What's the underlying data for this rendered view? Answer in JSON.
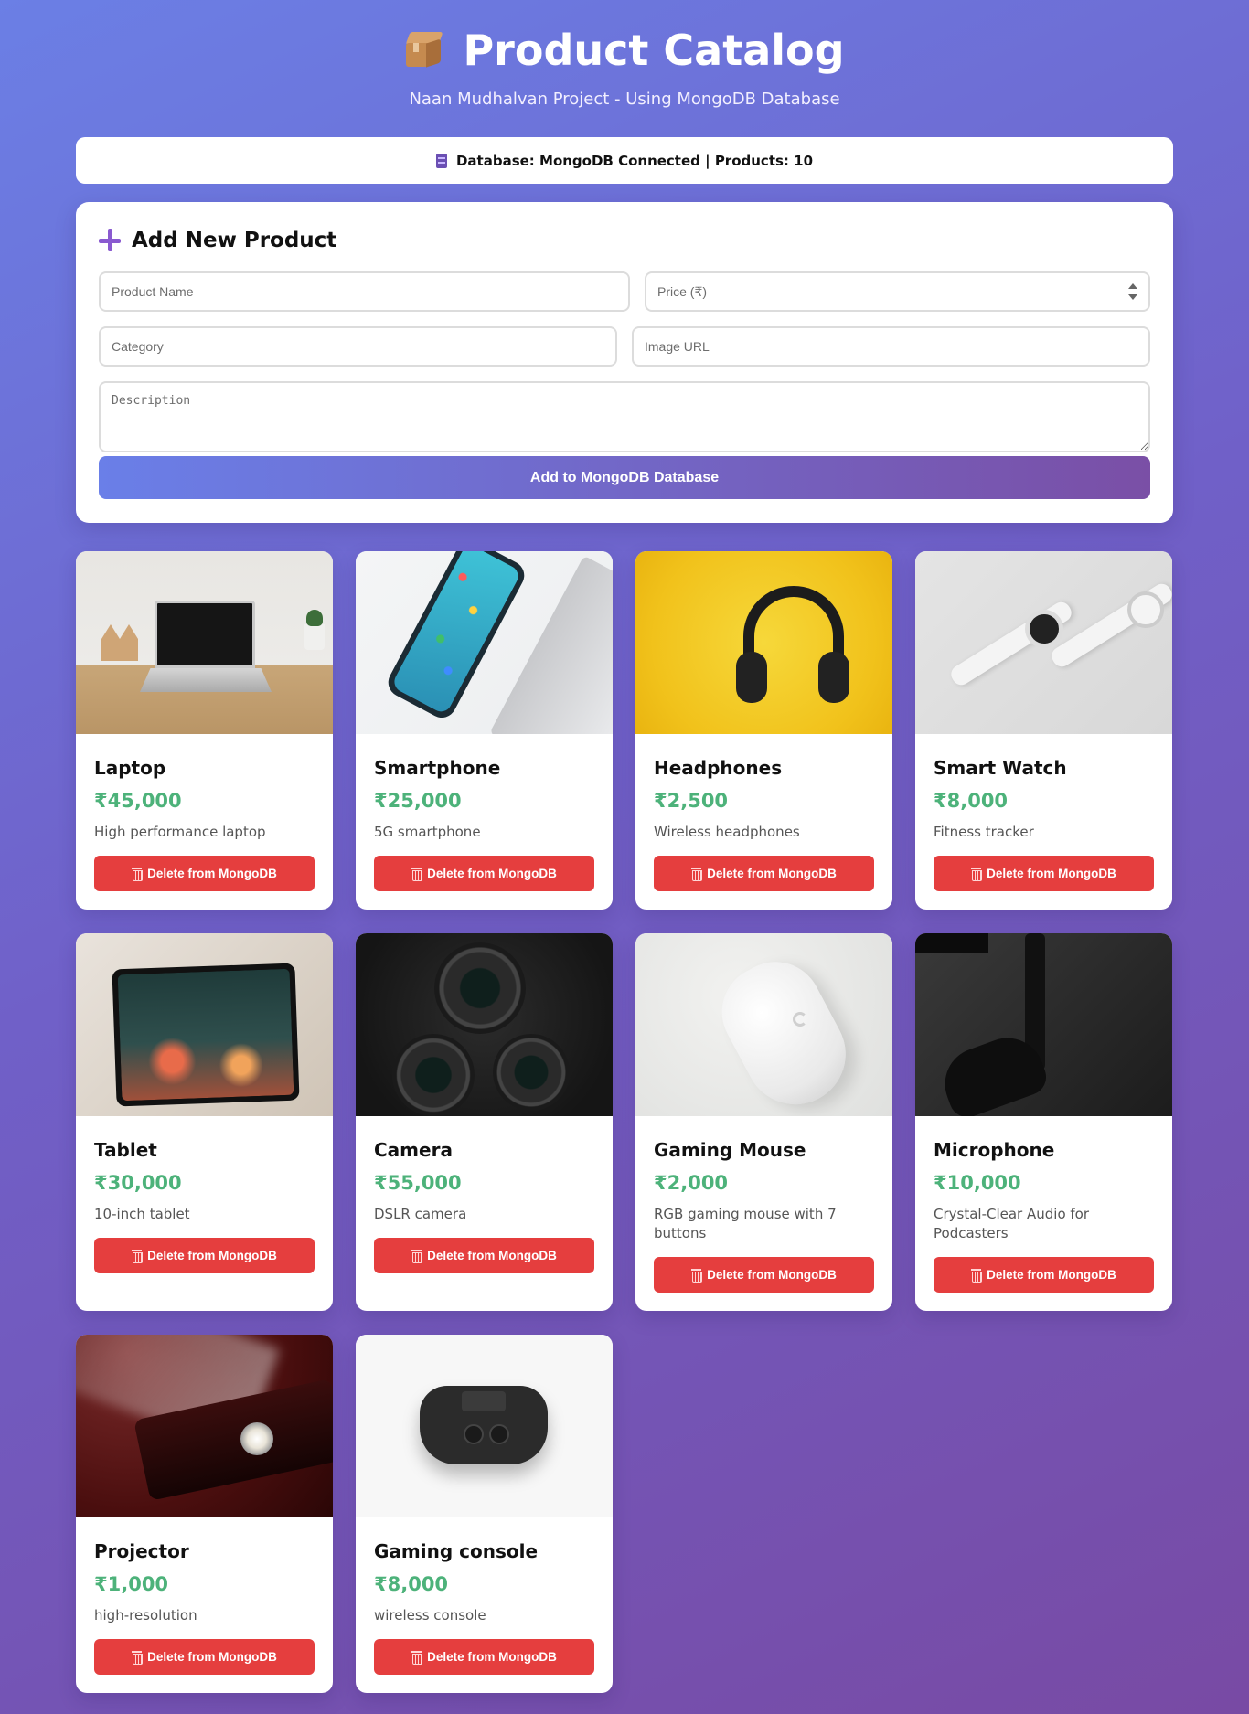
{
  "header": {
    "title": "Product Catalog",
    "subtitle": "Naan Mudhalvan Project - Using MongoDB Database",
    "icon": "package-icon"
  },
  "status": {
    "text": "Database: MongoDB Connected | Products: 10",
    "icon": "database-icon"
  },
  "form": {
    "title": "Add New Product",
    "name_placeholder": "Product Name",
    "price_placeholder": "Price (₹)",
    "category_placeholder": "Category",
    "image_placeholder": "Image URL",
    "description_placeholder": "Description",
    "submit_label": "Add to MongoDB Database"
  },
  "colors": {
    "accent": "#6a7fe8",
    "price": "#4db27a",
    "delete": "#e53e3e"
  },
  "delete_label": "Delete from MongoDB",
  "products": [
    {
      "name": "Laptop",
      "price": "₹45,000",
      "description": "High performance laptop"
    },
    {
      "name": "Smartphone",
      "price": "₹25,000",
      "description": "5G smartphone"
    },
    {
      "name": "Headphones",
      "price": "₹2,500",
      "description": "Wireless headphones"
    },
    {
      "name": "Smart Watch",
      "price": "₹8,000",
      "description": "Fitness tracker"
    },
    {
      "name": "Tablet",
      "price": "₹30,000",
      "description": "10-inch tablet"
    },
    {
      "name": "Camera",
      "price": "₹55,000",
      "description": "DSLR camera"
    },
    {
      "name": "Gaming Mouse",
      "price": "₹2,000",
      "description": "RGB gaming mouse with 7 buttons"
    },
    {
      "name": "Microphone",
      "price": "₹10,000",
      "description": "Crystal-Clear Audio for Podcasters"
    },
    {
      "name": "Projector",
      "price": "₹1,000",
      "description": "high-resolution"
    },
    {
      "name": "Gaming console",
      "price": "₹8,000",
      "description": "wireless console"
    }
  ]
}
